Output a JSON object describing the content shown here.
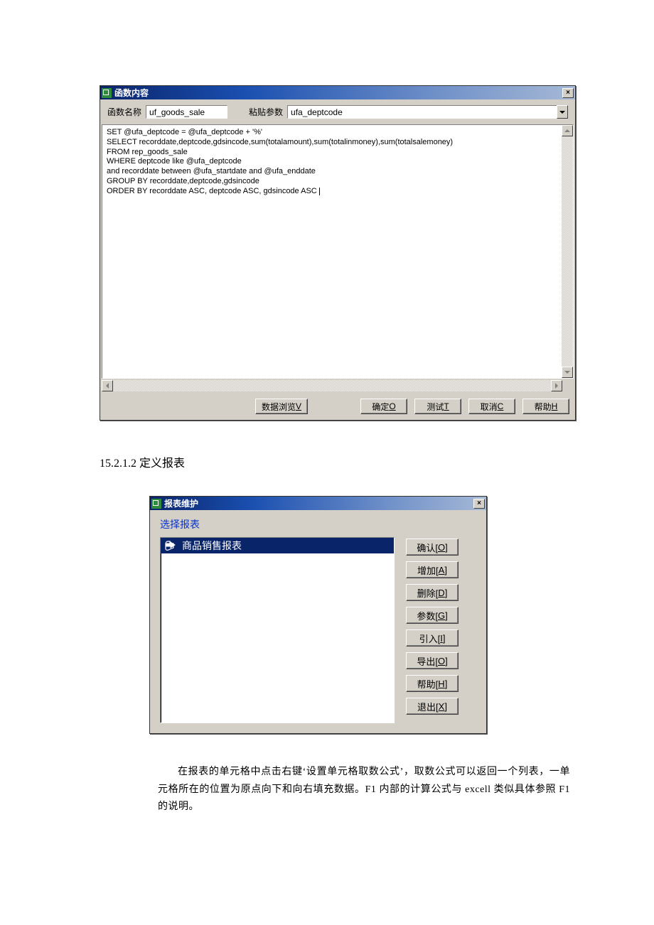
{
  "dialog1": {
    "title": "函数内容",
    "labels": {
      "function_name": "函数名称",
      "paste_param": "粘贴参数"
    },
    "function_name_value": "uf_goods_sale",
    "paste_param_value": "ufa_deptcode",
    "sql_text": "SET @ufa_deptcode = @ufa_deptcode + '%'\nSELECT recorddate,deptcode,gdsincode,sum(totalamount),sum(totalinmoney),sum(totalsalemoney)\nFROM rep_goods_sale\nWHERE deptcode like @ufa_deptcode\nand recorddate between @ufa_startdate and @ufa_enddate\nGROUP BY recorddate,deptcode,gdsincode\nORDER BY recorddate ASC, deptcode ASC, gdsincode ASC ",
    "buttons": {
      "data_browse": {
        "text": "数据浏览 ",
        "key": "V"
      },
      "ok": {
        "text": "确定 ",
        "key": "O"
      },
      "test": {
        "text": "测试 ",
        "key": "T"
      },
      "cancel": {
        "text": "取消 ",
        "key": "C"
      },
      "help": {
        "text": "帮助 ",
        "key": "H"
      }
    }
  },
  "section_heading": "15.2.1.2 定义报表",
  "dialog2": {
    "title": "报表维护",
    "select_label": "选择报表",
    "list_items": [
      "商品销售报表"
    ],
    "buttons": [
      {
        "name": "confirm",
        "text": "确认[",
        "key": "O",
        "tail": "]"
      },
      {
        "name": "add",
        "text": "增加[",
        "key": "A",
        "tail": "]"
      },
      {
        "name": "delete",
        "text": "删除[",
        "key": "D",
        "tail": "]"
      },
      {
        "name": "param",
        "text": "参数[",
        "key": "G",
        "tail": "]"
      },
      {
        "name": "import",
        "text": "引入[",
        "key": "I",
        "tail": "]"
      },
      {
        "name": "export",
        "text": "导出[",
        "key": "O",
        "tail": "]"
      },
      {
        "name": "help",
        "text": "帮助[",
        "key": "H",
        "tail": "]"
      },
      {
        "name": "exit",
        "text": "退出[",
        "key": "X",
        "tail": "]"
      }
    ]
  },
  "body_paragraph": "在报表的单元格中点击右键‘设置单元格取数公式’，取数公式可以返回一个列表，一单元格所在的位置为原点向下和向右填充数据。F1 内部的计算公式与 excell 类似具体参照 F1 的说明。"
}
